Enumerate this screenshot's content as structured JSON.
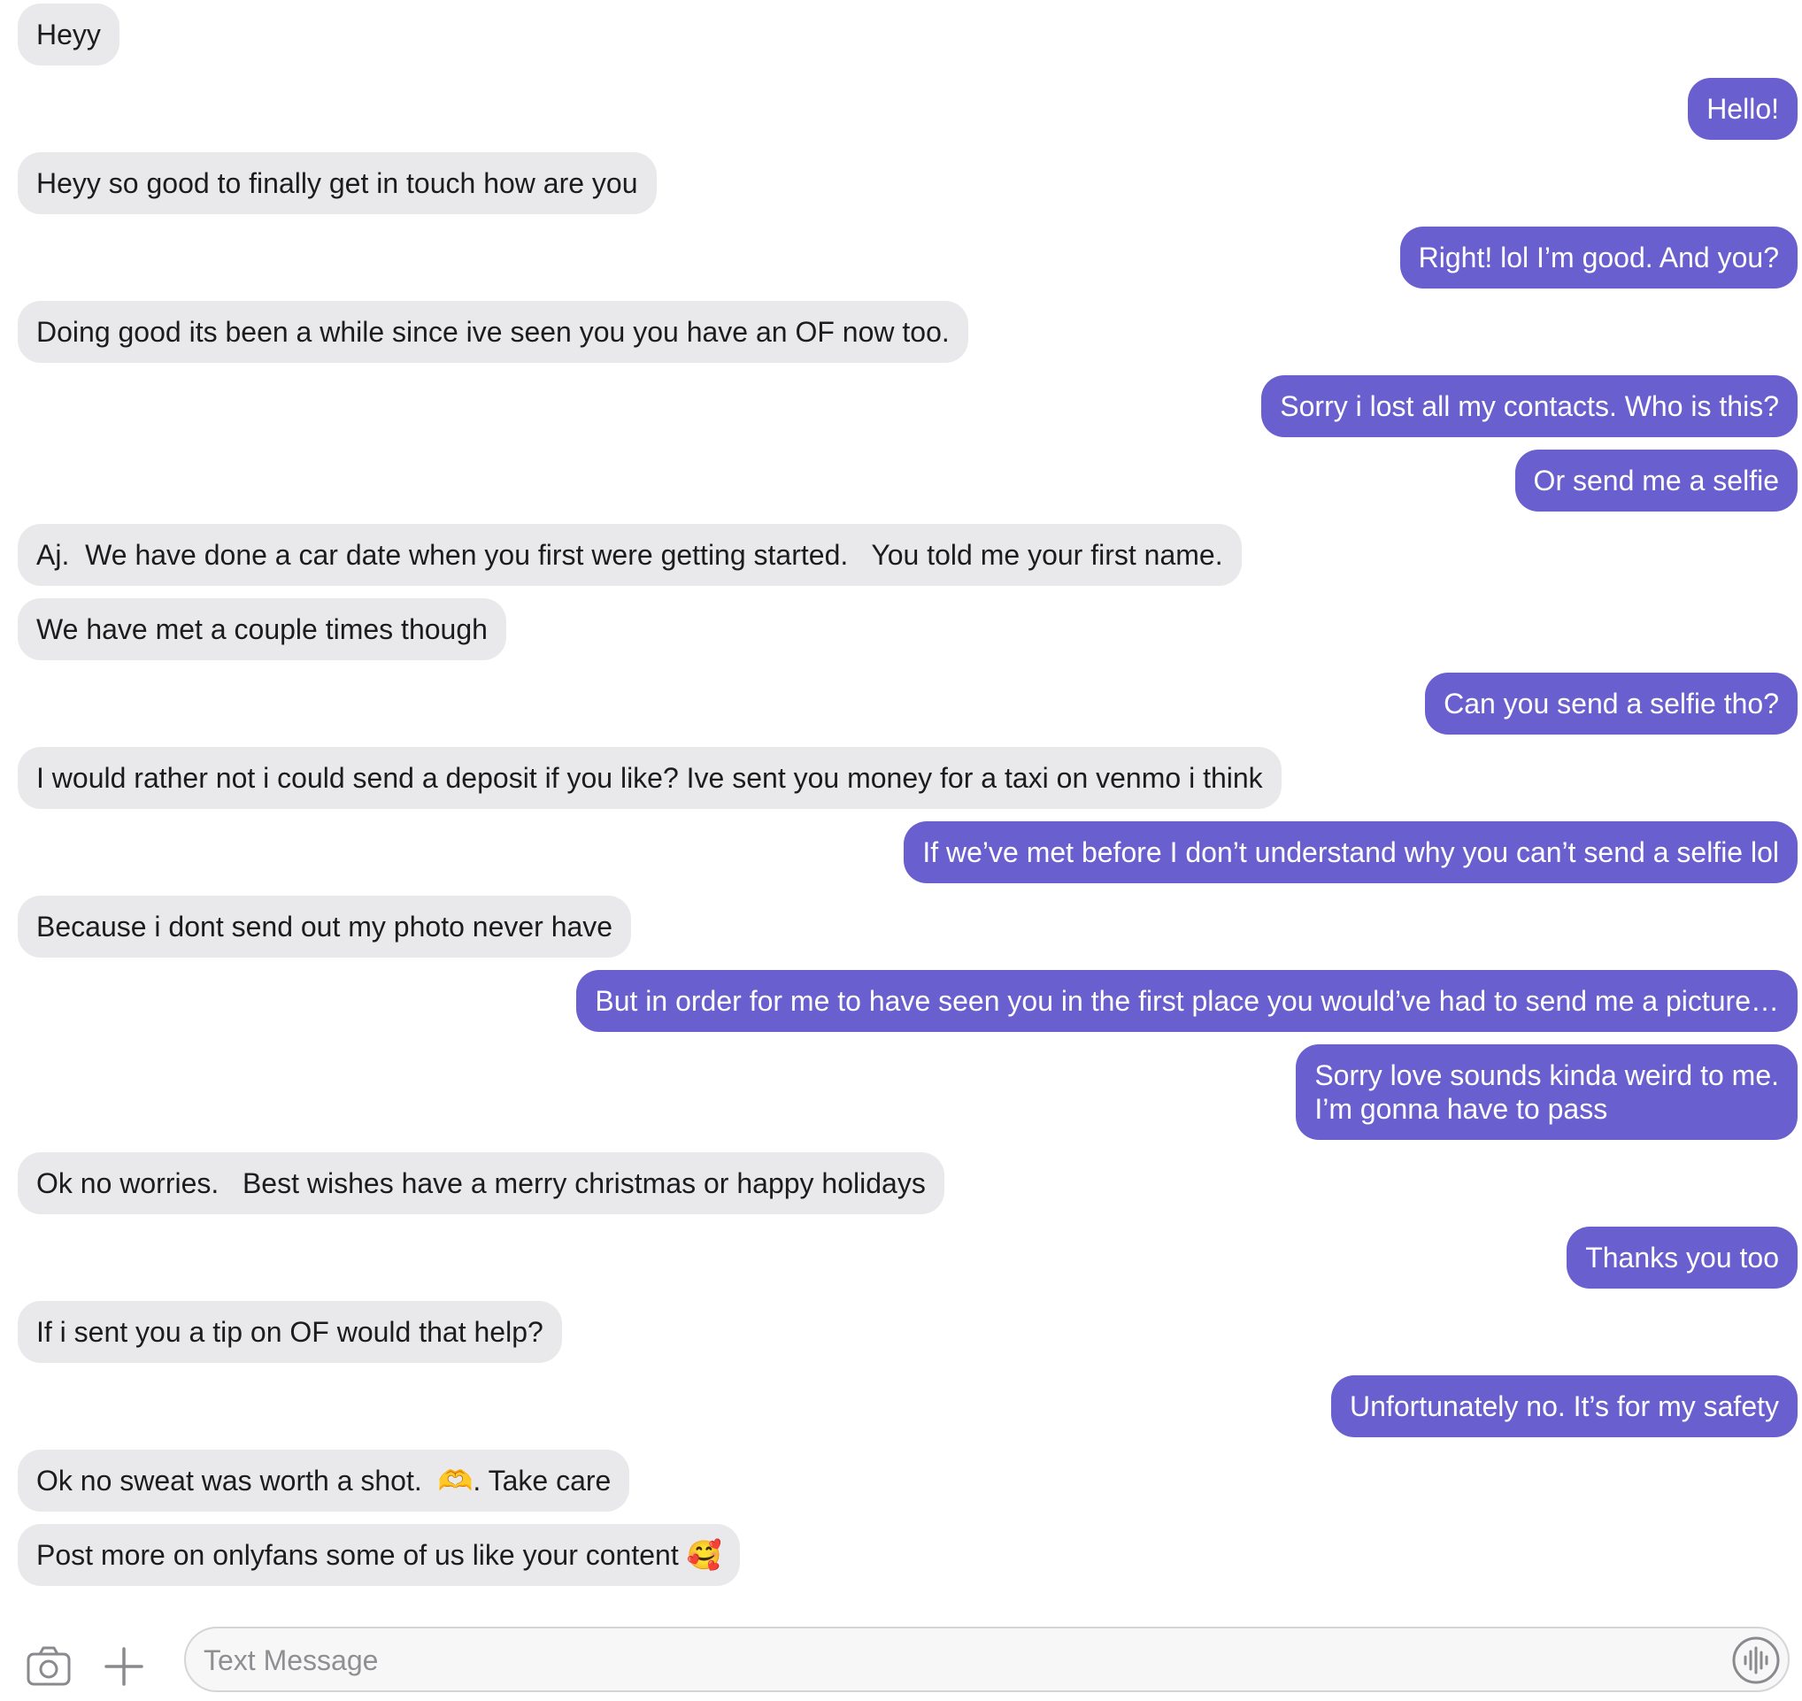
{
  "conversation": {
    "messages": [
      {
        "dir": "in",
        "text": "Heyy"
      },
      {
        "dir": "out",
        "text": "Hello!"
      },
      {
        "dir": "in",
        "text": "Heyy so good to finally get in touch how are you"
      },
      {
        "dir": "out",
        "text": "Right! lol I’m good. And you?"
      },
      {
        "dir": "in",
        "text": "Doing good its been a while since ive seen you you have an OF now too."
      },
      {
        "dir": "out",
        "text": "Sorry i lost all my contacts. Who is this?"
      },
      {
        "dir": "out",
        "text": "Or send me a selfie"
      },
      {
        "dir": "in",
        "text": "Aj.  We have done a car date when you first were getting started.   You told me your first name."
      },
      {
        "dir": "in",
        "text": "We have met a couple times though"
      },
      {
        "dir": "out",
        "text": "Can you send a selfie tho?"
      },
      {
        "dir": "in",
        "text": "I would rather not i could send a deposit if you like? Ive sent you money for a taxi on venmo i think"
      },
      {
        "dir": "out",
        "text": "If we’ve met before I don’t understand why you can’t send a selfie lol"
      },
      {
        "dir": "in",
        "text": "Because i dont send out my photo never have"
      },
      {
        "dir": "out",
        "text": "But in order for me to have seen you in the first place you would’ve had to send me a picture…"
      },
      {
        "dir": "out",
        "text": "Sorry love sounds kinda weird to me.\nI’m gonna have to pass"
      },
      {
        "dir": "in",
        "text": "Ok no worries.   Best wishes have a merry christmas or happy holidays"
      },
      {
        "dir": "out",
        "text": "Thanks you too"
      },
      {
        "dir": "in",
        "text": "If i sent you a tip on OF would that help?"
      },
      {
        "dir": "out",
        "text": "Unfortunately no. It’s for my safety"
      },
      {
        "dir": "in",
        "text": "Ok no sweat was worth a shot.  🫶. Take care"
      },
      {
        "dir": "in",
        "text": "Post more on onlyfans some of us like your content 🥰"
      }
    ]
  },
  "composer": {
    "placeholder": "Text Message",
    "value": "",
    "camera_icon": "camera-icon",
    "plus_icon": "plus-icon",
    "voice_icon": "waveform-icon"
  },
  "colors": {
    "incoming_bubble": "#e9e9eb",
    "outgoing_bubble": "#6a5fcf",
    "outgoing_text": "#ffffff",
    "incoming_text": "#1c1c1e"
  }
}
